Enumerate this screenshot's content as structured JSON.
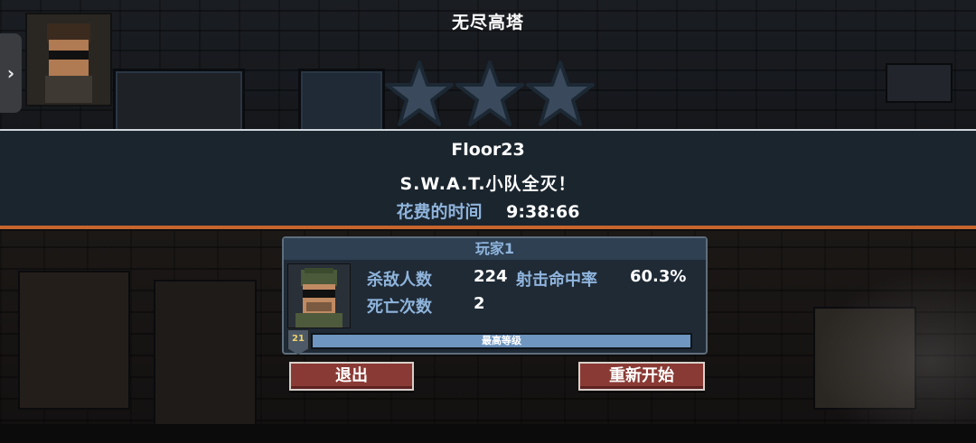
{
  "header": {
    "title": "无尽高塔"
  },
  "side_toggle": {
    "label": "›"
  },
  "rating": {
    "stars_earned": 0,
    "stars_total": 3
  },
  "result": {
    "floor": "Floor23",
    "message": "S.W.A.T.小队全灭！",
    "time_label": "花费的时间",
    "time_value": "9:38:66"
  },
  "player": {
    "name": "玩家1",
    "kills_label": "杀敌人数",
    "kills_value": "224",
    "accuracy_label": "射击命中率",
    "accuracy_value": "60.3%",
    "deaths_label": "死亡次数",
    "deaths_value": "2",
    "level": "21",
    "xp_label": "最高等级",
    "xp_progress": 1.0
  },
  "buttons": {
    "exit": "退出",
    "restart": "重新开始"
  },
  "colors": {
    "accent_blue": "#8fb4dc",
    "banner_bottom": "#c7652e",
    "button_red": "#8a3a34",
    "star_outline": "#1c2833",
    "star_fill": "#3a4a5c"
  }
}
